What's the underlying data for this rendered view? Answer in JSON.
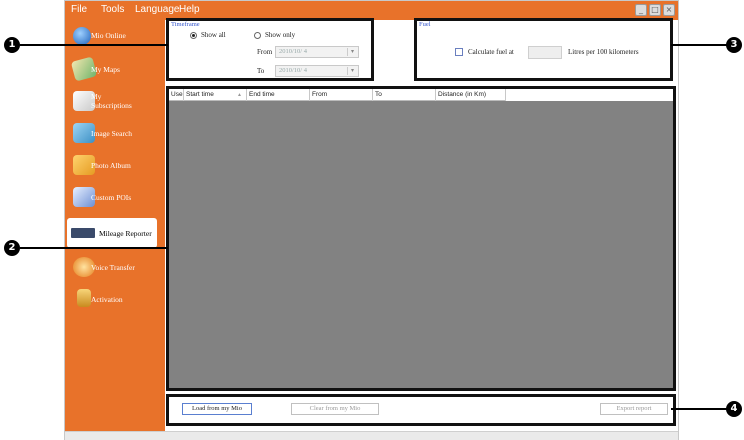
{
  "menu": {
    "file": "File",
    "tools": "Tools",
    "language": "Language",
    "help": "Help"
  },
  "window_controls": {
    "minimize": "_",
    "maximize": "□",
    "close": "×"
  },
  "sidebar": {
    "items": [
      {
        "label": "Mio Online",
        "icon": "globe-icon"
      },
      {
        "label": "My Maps",
        "icon": "maps-icon"
      },
      {
        "label": "My Subscriptions",
        "icon": "subscriptions-icon"
      },
      {
        "label": "Image Search",
        "icon": "image-search-icon"
      },
      {
        "label": "Photo Album",
        "icon": "photo-album-icon"
      },
      {
        "label": "Custom POIs",
        "icon": "custom-pois-icon"
      },
      {
        "label": "Mileage Reporter",
        "icon": "mileage-reporter-icon",
        "active": true
      },
      {
        "label": "Voice Transfer",
        "icon": "voice-transfer-icon"
      },
      {
        "label": "Activation",
        "icon": "activation-icon"
      }
    ]
  },
  "timeframe": {
    "legend": "Timeframe",
    "show_all": "Show all",
    "show_only": "Show only",
    "from_label": "From",
    "to_label": "To",
    "from_value": "2010/10/ 4",
    "to_value": "2010/10/ 4"
  },
  "fuel": {
    "legend": "Fuel",
    "calculate_label": "Calculate fuel at",
    "unit_label": "Litres per 100 kilometers"
  },
  "grid": {
    "columns": [
      "Use",
      "Start time",
      "End time",
      "From",
      "To",
      "Distance (in Km)"
    ]
  },
  "actions": {
    "load": "Load from my Mio",
    "clear": "Clear from my Mio",
    "export": "Export report"
  },
  "callouts": [
    "1",
    "2",
    "3",
    "4"
  ],
  "colors": {
    "accent": "#e8722a",
    "grid_bg": "#828282",
    "callout": "#000000"
  }
}
